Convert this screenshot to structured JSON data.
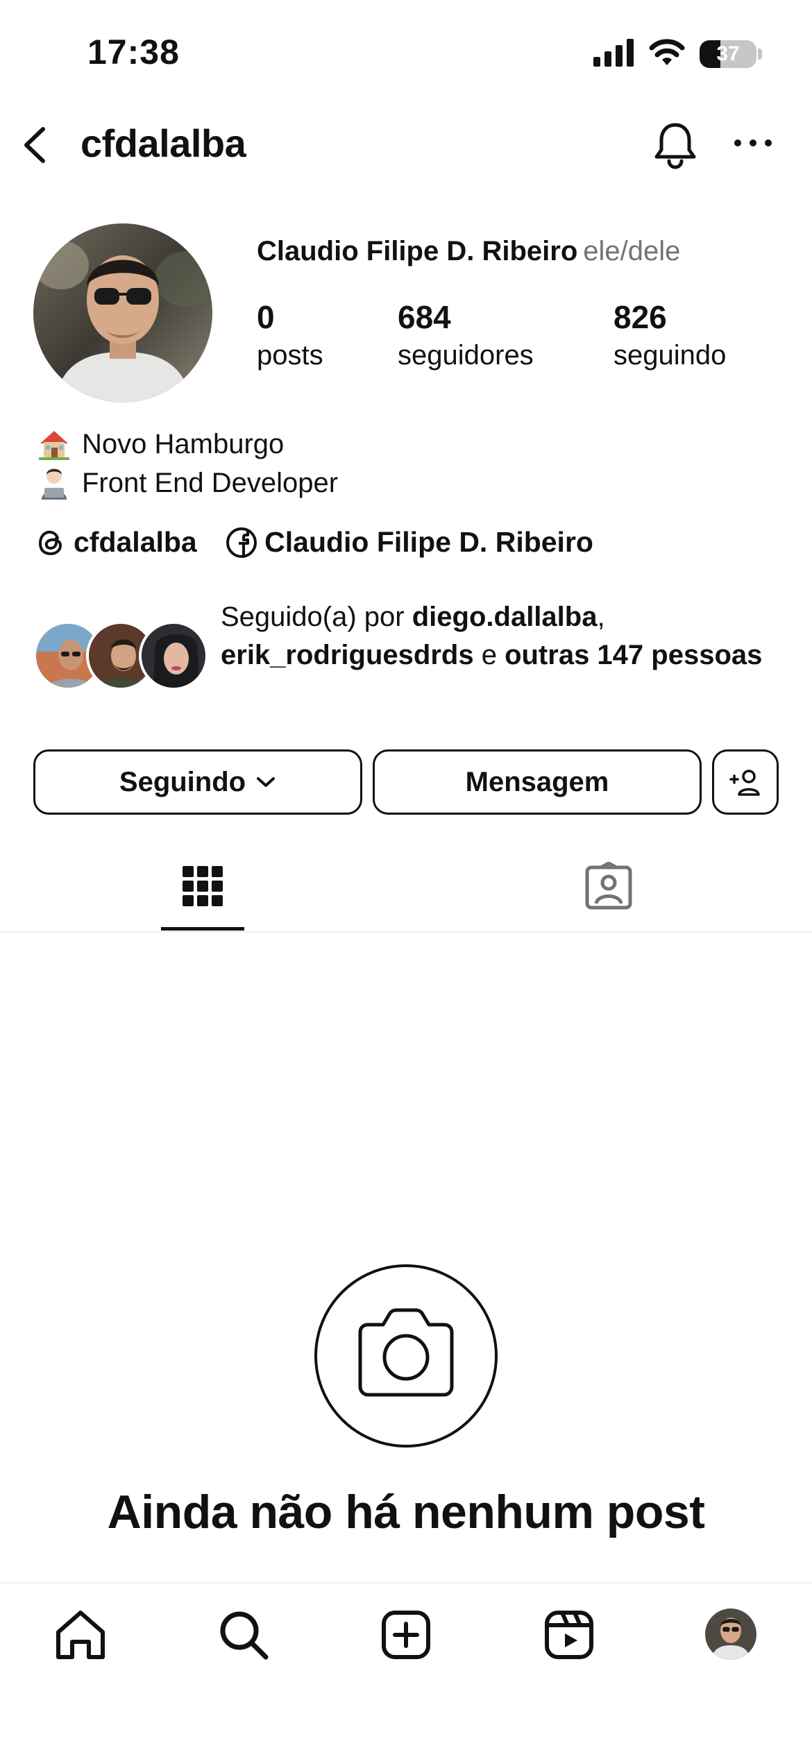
{
  "status_bar": {
    "time": "17:38",
    "battery_level": "37",
    "icons": [
      "signal-icon",
      "wifi-icon",
      "battery-icon"
    ]
  },
  "header": {
    "username": "cfdalalba",
    "icons": [
      "back-icon",
      "bell-icon",
      "more-icon"
    ]
  },
  "profile": {
    "full_name": "Claudio Filipe D. Ribeiro",
    "pronouns": "ele/dele",
    "stats": [
      {
        "value": "0",
        "label": "posts"
      },
      {
        "value": "684",
        "label": "seguidores"
      },
      {
        "value": "826",
        "label": "seguindo"
      }
    ],
    "bio": [
      {
        "emoji": "house-emoji",
        "text": "Novo Hamburgo"
      },
      {
        "emoji": "technologist-emoji",
        "text": "Front End Developer"
      }
    ],
    "links": {
      "threads": "cfdalalba",
      "facebook": "Claudio Filipe D. Ribeiro"
    },
    "followed_by": {
      "prefix": "Seguido(a) por ",
      "user1": "diego.dallalba",
      "sep": ",",
      "user2": "erik_rodriguesdrds",
      "conj": " e ",
      "others": "outras 147 pessoas"
    }
  },
  "actions": {
    "following_label": "Seguindo",
    "message_label": "Mensagem"
  },
  "tabs": {
    "active": "grid",
    "items": [
      "grid-icon",
      "tagged-icon"
    ]
  },
  "empty_state": {
    "title": "Ainda não há nenhum post"
  },
  "bottom_nav": {
    "items": [
      "home-icon",
      "search-icon",
      "create-icon",
      "reels-icon",
      "profile-avatar"
    ]
  }
}
